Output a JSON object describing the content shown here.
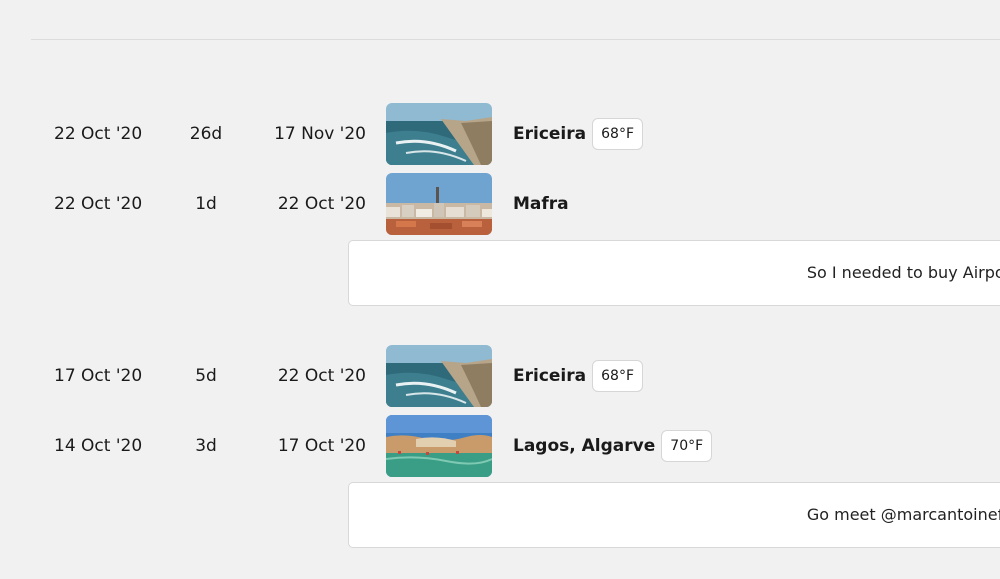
{
  "trips": [
    {
      "start": "22 Oct '20",
      "duration": "26d",
      "end": "17 Nov '20",
      "place": "Ericeira",
      "temperature": "68°F",
      "photo": "coast-cliffs-photo"
    },
    {
      "start": "22 Oct '20",
      "duration": "1d",
      "end": "22 Oct '20",
      "place": "Mafra",
      "temperature": "",
      "photo": "town-rooftops-photo"
    },
    {
      "start": "17 Oct '20",
      "duration": "5d",
      "end": "22 Oct '20",
      "place": "Ericeira",
      "temperature": "68°F",
      "photo": "coast-cliffs-photo"
    },
    {
      "start": "14 Oct '20",
      "duration": "3d",
      "end": "17 Oct '20",
      "place": "Lagos, Algarve",
      "temperature": "70°F",
      "photo": "beach-bay-photo"
    }
  ],
  "notes": [
    {
      "text": "So I needed to buy Airpods"
    },
    {
      "text": "Go meet @marcantoinefon"
    }
  ]
}
